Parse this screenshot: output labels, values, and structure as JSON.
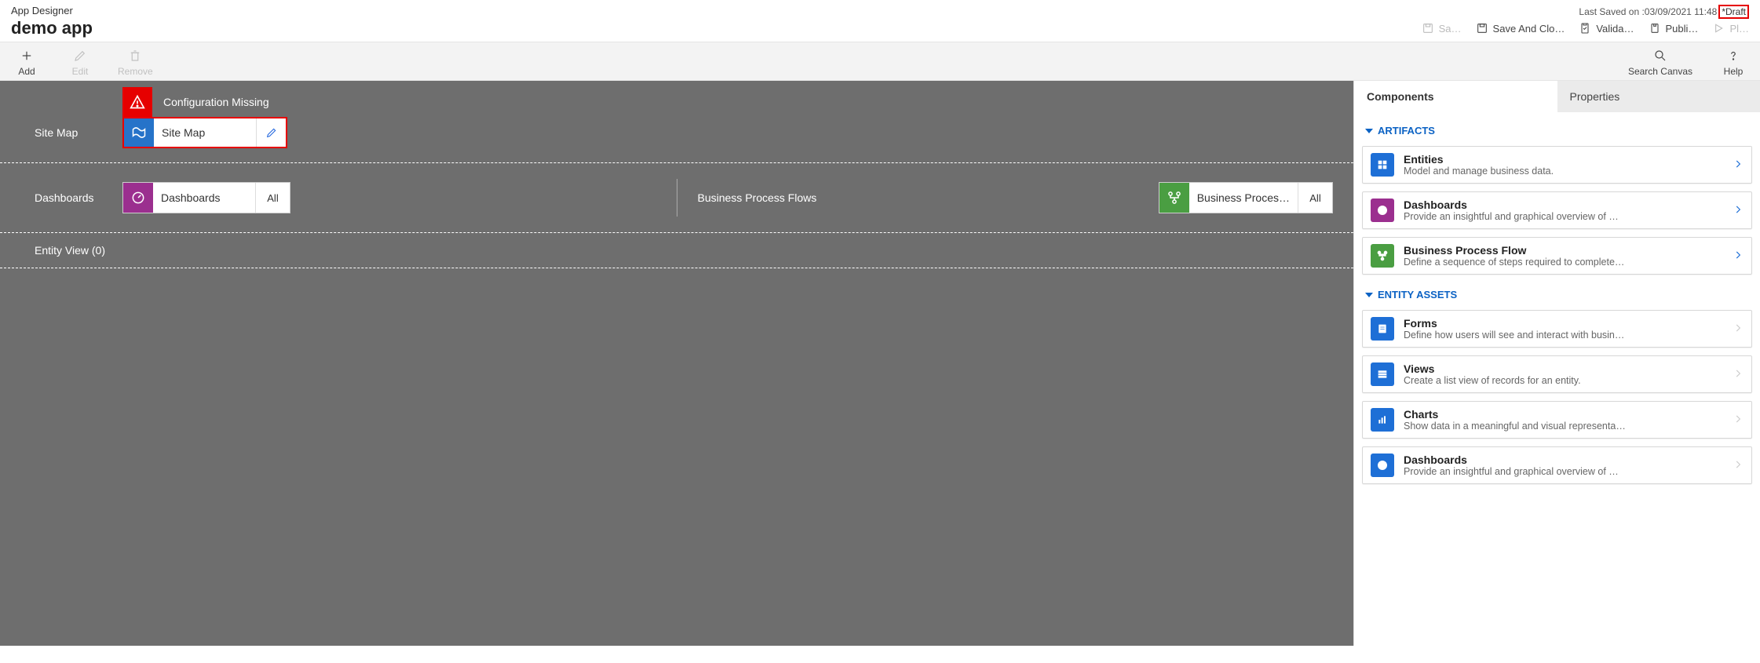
{
  "header": {
    "app_designer": "App Designer",
    "app_name": "demo app",
    "last_saved": "Last Saved on :03/09/2021 11:48",
    "draft": "*Draft",
    "actions": {
      "save": "Sa…",
      "save_close": "Save And Clo…",
      "validate": "Valida…",
      "publish": "Publi…",
      "play": "Pl…"
    }
  },
  "toolbar": {
    "add": "Add",
    "edit": "Edit",
    "remove": "Remove",
    "search": "Search Canvas",
    "help": "Help"
  },
  "canvas": {
    "config_missing": "Configuration Missing",
    "sitemap_label": "Site Map",
    "sitemap_tile": "Site Map",
    "dashboards_label": "Dashboards",
    "dashboards_tile": "Dashboards",
    "dashboards_count": "All",
    "bpf_label": "Business Process Flows",
    "bpf_tile": "Business Proces…",
    "bpf_count": "All",
    "entity_view": "Entity View (0)"
  },
  "sidepanel": {
    "tabs": {
      "components": "Components",
      "properties": "Properties"
    },
    "sections": {
      "artifacts": "ARTIFACTS",
      "entity_assets": "ENTITY ASSETS"
    },
    "artifacts": [
      {
        "title": "Entities",
        "desc": "Model and manage business data."
      },
      {
        "title": "Dashboards",
        "desc": "Provide an insightful and graphical overview of …"
      },
      {
        "title": "Business Process Flow",
        "desc": "Define a sequence of steps required to complete…"
      }
    ],
    "entity_assets": [
      {
        "title": "Forms",
        "desc": "Define how users will see and interact with busin…"
      },
      {
        "title": "Views",
        "desc": "Create a list view of records for an entity."
      },
      {
        "title": "Charts",
        "desc": "Show data in a meaningful and visual representa…"
      },
      {
        "title": "Dashboards",
        "desc": "Provide an insightful and graphical overview of …"
      }
    ]
  }
}
